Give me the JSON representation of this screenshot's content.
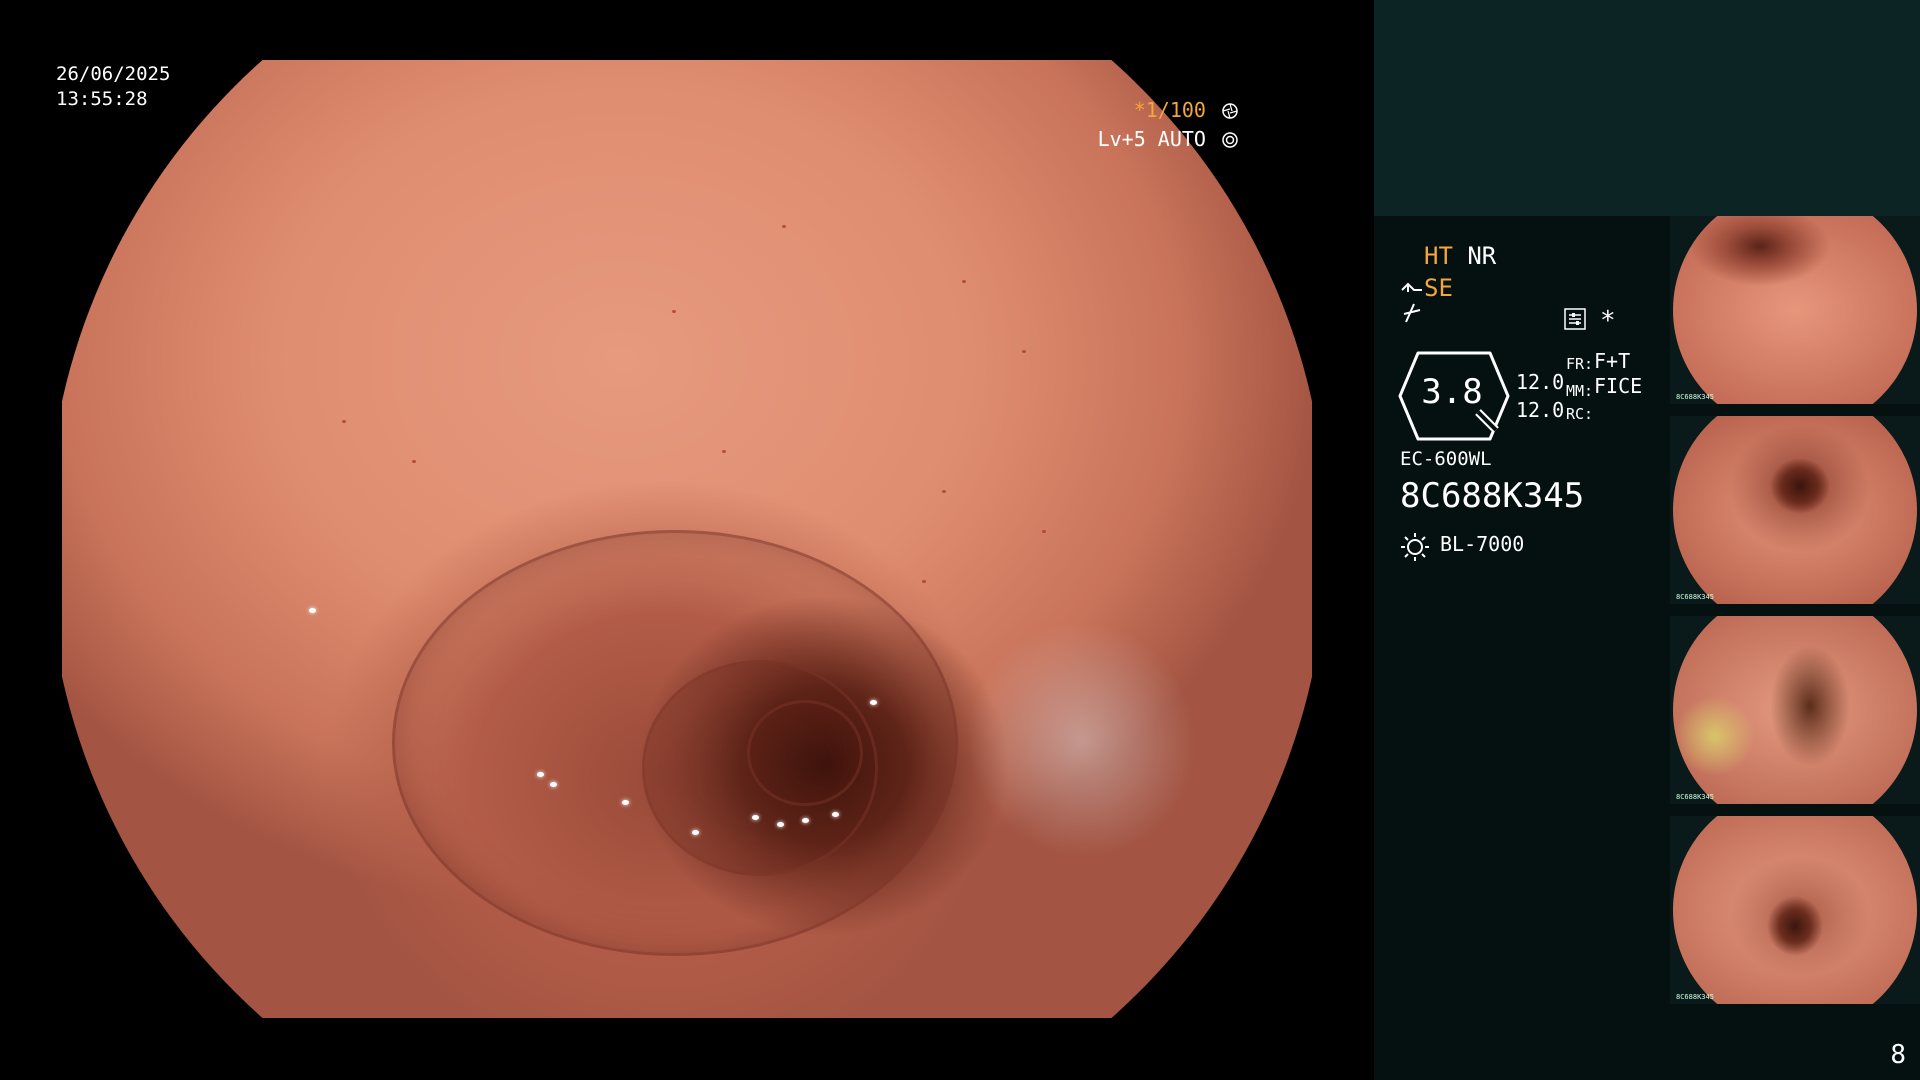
{
  "overlay": {
    "date": "26/06/2025",
    "time": "13:55:28",
    "shutter": "*1/100",
    "level": "Lv+5 AUTO"
  },
  "panel": {
    "ht": "HT",
    "nr": "NR",
    "se": "SE",
    "asterisk": "*",
    "zoom": "3.8",
    "value_top": "12.0",
    "value_bottom": "12.0",
    "fr_label": "FR:",
    "fr_value": "F+T",
    "mm_label": "MM:",
    "mm_value": "FICE",
    "rc_label": "RC:",
    "scope_model": "EC-600WL",
    "scope_serial": "8C688K345",
    "processor": "BL-7000",
    "page_number": "8",
    "thumbnail_caption": "8C688K345"
  },
  "colors": {
    "accent_orange": "#f3a63a",
    "panel_bg": "#051010",
    "panel_top_bg": "#0c2424"
  },
  "icons": {
    "shutter": "aperture-icon",
    "auto_level": "iris-icon",
    "structure_enhance": "enhance-curve-icon",
    "color_enhance": "slash-curve-icon",
    "settings": "settings-sliders-icon",
    "lamp": "light-source-icon",
    "zoom": "magnifier-hexagon-icon"
  }
}
